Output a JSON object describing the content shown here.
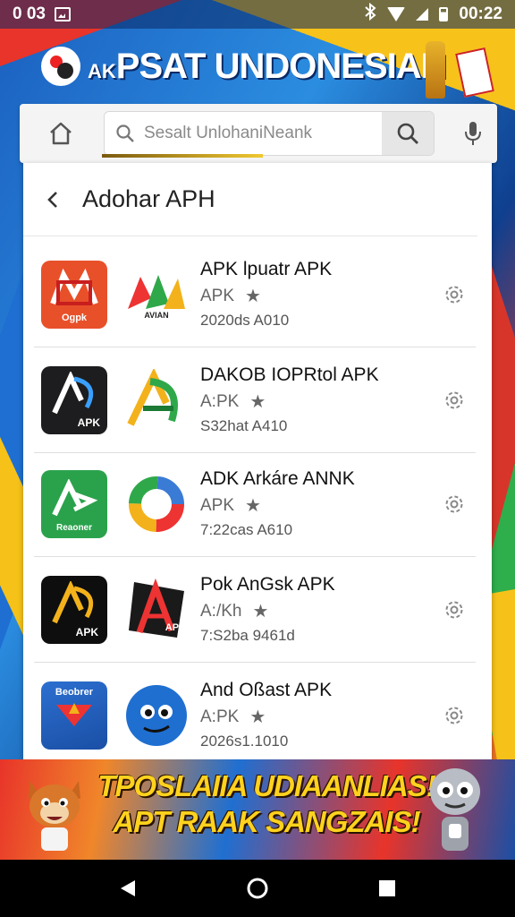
{
  "status_bar": {
    "left_text": "0 03",
    "time": "00:22",
    "icons": [
      "image-icon",
      "bluetooth-icon",
      "wifi-icon",
      "signal-icon",
      "battery-icon"
    ]
  },
  "banner": {
    "prefix": "AK",
    "title": "PSAT UNDONESIAN"
  },
  "search": {
    "placeholder": "Sesalt UnlohaniNeank",
    "icons": [
      "home-icon",
      "search-icon",
      "mic-icon"
    ]
  },
  "panel": {
    "title": "Adohar APH",
    "apps": [
      {
        "name": "APK lpuatr APK",
        "meta": "APK",
        "sub": "2020ds A010",
        "icon1_label": "Ogpk",
        "icon2_label": "AVIAN"
      },
      {
        "name": "DAKOB IOPRtol APK",
        "meta": "A:PK",
        "sub": "S32hat A410",
        "icon1_label": "APK",
        "icon2_label": ""
      },
      {
        "name": "ADK Arkáre ANNK",
        "meta": "APK",
        "sub": "7:22cas A610",
        "icon1_label": "Reaoner",
        "icon2_label": ""
      },
      {
        "name": "Pok AnGsk APK",
        "meta": "A:/Kh",
        "sub": "7:S2ba 9461d",
        "icon1_label": "APK",
        "icon2_label": "APK"
      },
      {
        "name": "And Oßast APK",
        "meta": "A:PK",
        "sub": "2026s1.1010",
        "icon1_label": "Beobrer",
        "icon2_label": ""
      }
    ]
  },
  "promo": {
    "line1": "TPOSLAIIA UDIAANLIAS!",
    "line2": "APT RAAK SANGZAIS!"
  },
  "nav": {
    "icons": [
      "back-icon",
      "home-icon",
      "recents-icon"
    ]
  },
  "colors": {
    "accent_red": "#e8342a",
    "accent_blue": "#1f6fd1",
    "accent_yellow": "#ffd21e"
  }
}
